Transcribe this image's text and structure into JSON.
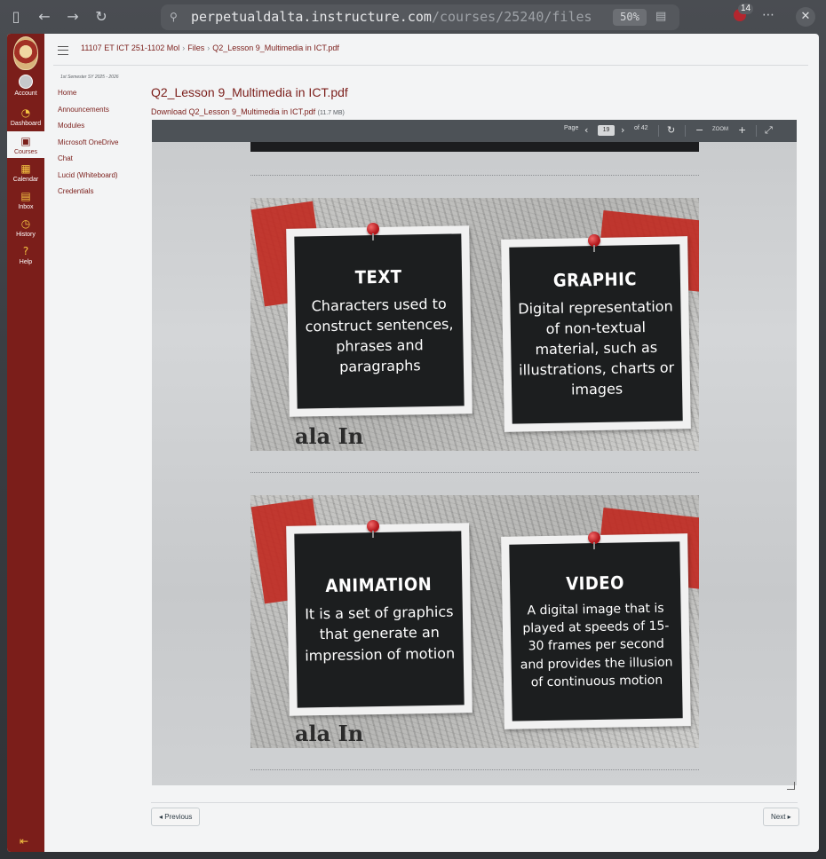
{
  "browser": {
    "url_host": "perpetualdalta.instructure.com",
    "url_prefix": "",
    "url_path": "/courses/25240/files",
    "zoom": "50%",
    "extension_badge": "14"
  },
  "nav": {
    "account": "Account",
    "dashboard": "Dashboard",
    "courses": "Courses",
    "calendar": "Calendar",
    "inbox": "Inbox",
    "history": "History",
    "help": "Help"
  },
  "breadcrumb": {
    "course": "11107 ET ICT 251-1102 Mol",
    "files": "Files",
    "file": "Q2_Lesson 9_Multimedia in ICT.pdf"
  },
  "course_nav": {
    "term": "1st Semester SY 2025 - 2026",
    "links": [
      "Home",
      "Announcements",
      "Modules",
      "Microsoft OneDrive",
      "Chat",
      "Lucid (Whiteboard)",
      "Credentials"
    ]
  },
  "file": {
    "title": "Q2_Lesson 9_Multimedia in ICT.pdf",
    "download_label": "Download Q2_Lesson 9_Multimedia in ICT.pdf",
    "size": "(11.7 MB)"
  },
  "viewer": {
    "page_label": "Page",
    "page_number": "19",
    "page_total": "of 42",
    "zoom_label": "ZOOM"
  },
  "slides": [
    {
      "cards": [
        {
          "title": "TEXT",
          "body": "Characters used to construct sentences, phrases and paragraphs"
        },
        {
          "title": "GRAPHIC",
          "body": "Digital representation of non-textual material, such as illustrations, charts or images"
        }
      ],
      "background_word": "ala In"
    },
    {
      "cards": [
        {
          "title": "ANIMATION",
          "body": "It is a set of graphics that generate an impression of motion"
        },
        {
          "title": "VIDEO",
          "body": "A digital image that is played at speeds of 15-30 frames per second and provides the illusion of continuous motion"
        }
      ],
      "background_word": "ala In"
    }
  ],
  "pager": {
    "previous": "◂ Previous",
    "next": "Next ▸"
  }
}
